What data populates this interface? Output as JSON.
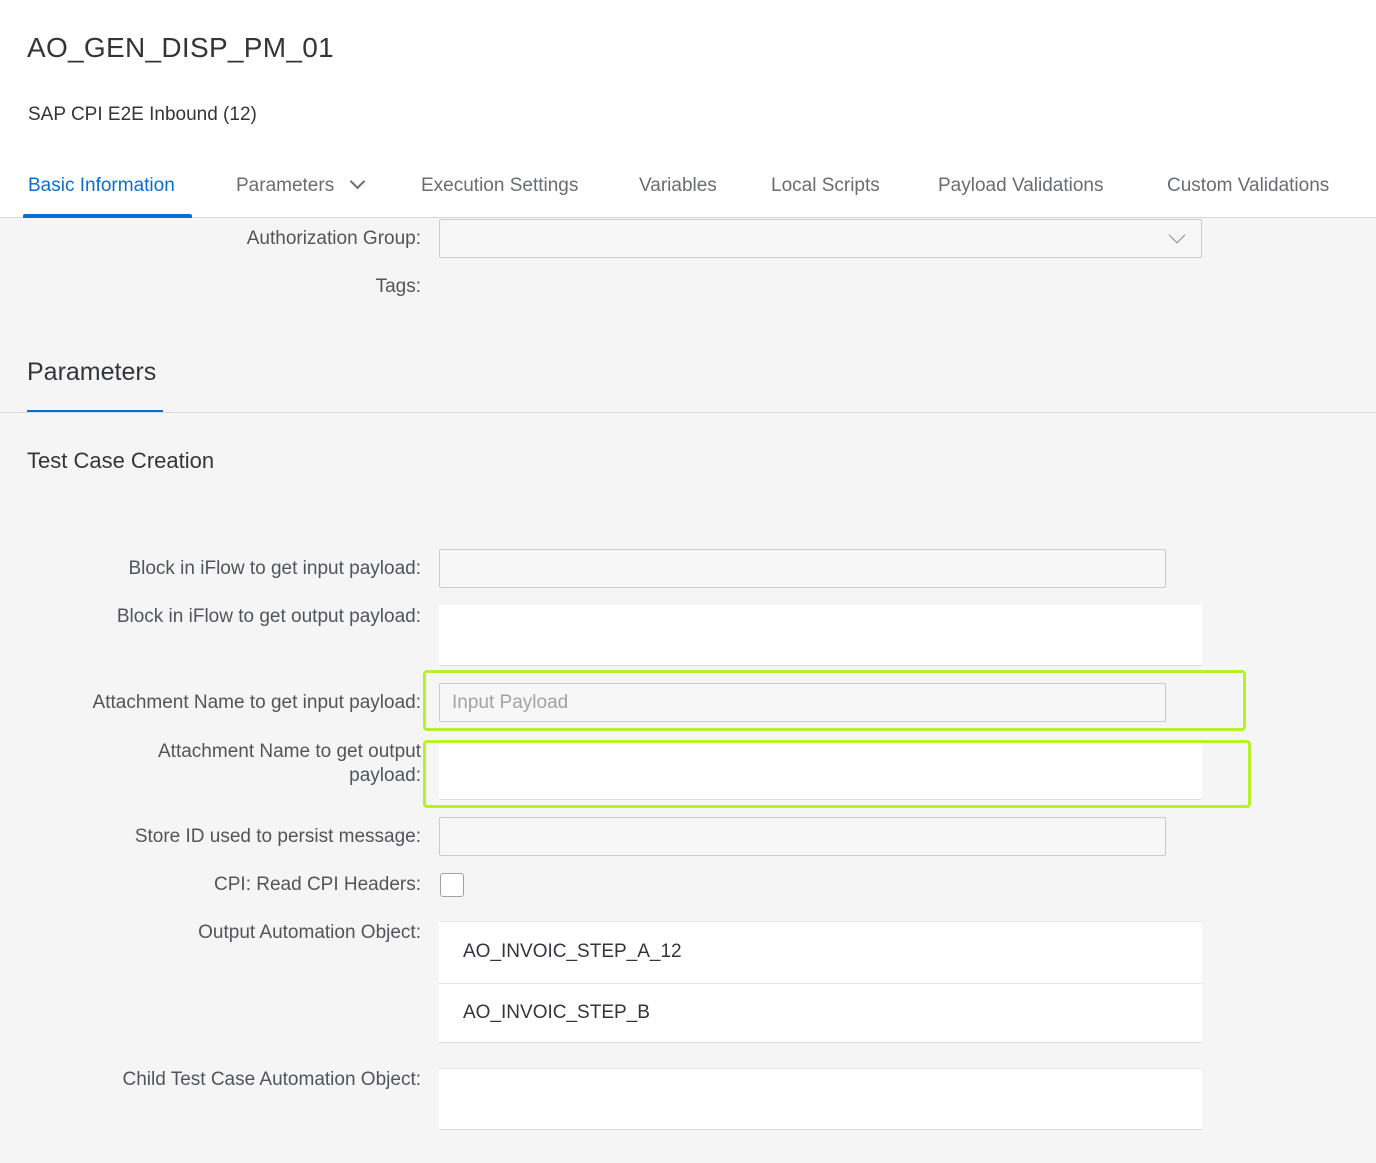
{
  "header": {
    "title": "AO_GEN_DISP_PM_01",
    "subtitle": "SAP CPI E2E Inbound (12)"
  },
  "tabs": [
    {
      "label": "Basic Information",
      "active": true
    },
    {
      "label": "Parameters",
      "has_dropdown": true
    },
    {
      "label": "Execution Settings"
    },
    {
      "label": "Variables"
    },
    {
      "label": "Local Scripts"
    },
    {
      "label": "Payload Validations"
    },
    {
      "label": "Custom Validations"
    }
  ],
  "basic_info": {
    "authorization_group_label": "Authorization Group:",
    "authorization_group_value": "",
    "tags_label": "Tags:"
  },
  "parameters_section": {
    "title": "Parameters",
    "subsection_title": "Test Case Creation",
    "fields": {
      "block_input_label": "Block in iFlow to get input payload:",
      "block_output_label": "Block in iFlow to get output payload:",
      "attachment_input_label": "Attachment Name to get input payload:",
      "attachment_input_placeholder": "Input Payload",
      "attachment_output_label": "Attachment Name to get output payload:",
      "store_id_label": "Store ID used to persist message:",
      "cpi_headers_label": "CPI: Read CPI Headers:",
      "cpi_headers_checked": false,
      "output_ao_label": "Output Automation Object:",
      "output_ao_items": [
        "AO_INVOIC_STEP_A_12",
        "AO_INVOIC_STEP_B"
      ],
      "child_ao_label": "Child Test Case Automation Object:"
    }
  },
  "colors": {
    "accent": "#0a6ed1",
    "highlight": "#b6f22a",
    "background": "#f5f5f5"
  }
}
